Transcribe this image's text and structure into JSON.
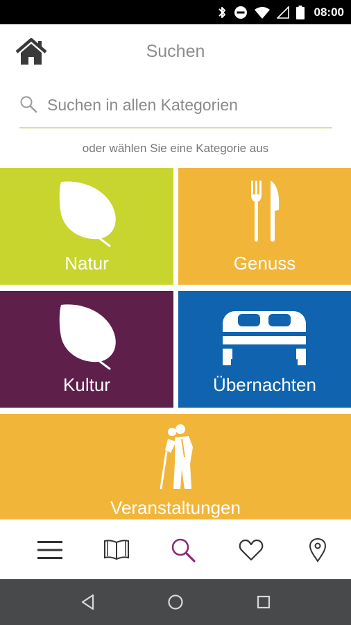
{
  "status_bar": {
    "time": "08:00",
    "icons": [
      "bluetooth-icon",
      "do-not-disturb-icon",
      "wifi-icon",
      "signal-icon",
      "battery-icon"
    ]
  },
  "header": {
    "title": "Suchen",
    "home_icon": "home-icon"
  },
  "search": {
    "placeholder": "Suchen in allen Kategorien",
    "value": "",
    "icon": "search-icon",
    "underline_color": "#d6e09a"
  },
  "subtitle": "oder wählen Sie eine Kategorie aus",
  "categories": [
    {
      "label": "Natur",
      "icon": "leaf-icon",
      "color": "#c8d52e"
    },
    {
      "label": "Genuss",
      "icon": "fork-knife-icon",
      "color": "#f1b53a"
    },
    {
      "label": "Kultur",
      "icon": "leaf-icon",
      "color": "#5e1f4b"
    },
    {
      "label": "Übernachten",
      "icon": "bed-icon",
      "color": "#1063ae"
    },
    {
      "label": "Veranstaltungen",
      "icon": "dancing-couple-icon",
      "color": "#f1b53a"
    }
  ],
  "bottom_nav": {
    "items": [
      {
        "name": "menu-icon",
        "active": false
      },
      {
        "name": "book-icon",
        "active": false
      },
      {
        "name": "search-icon",
        "active": true
      },
      {
        "name": "heart-icon",
        "active": false
      },
      {
        "name": "location-pin-icon",
        "active": false
      }
    ],
    "active_color": "#8b2a78",
    "inactive_color": "#333333"
  },
  "system_nav": {
    "buttons": [
      "back-icon",
      "home-circle-icon",
      "recents-icon"
    ]
  }
}
